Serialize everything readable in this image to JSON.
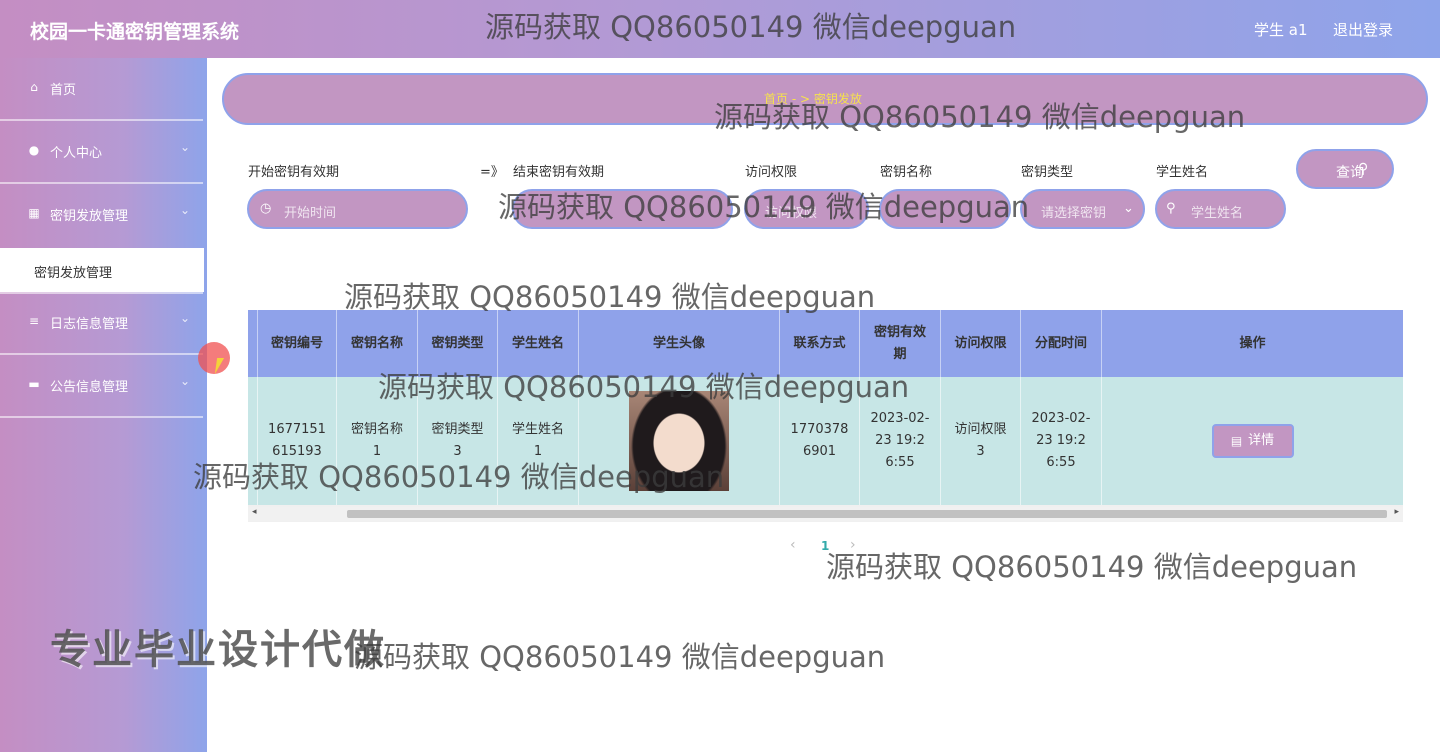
{
  "app": {
    "title": "校园一卡通密钥管理系统",
    "user": "学生 a1",
    "logout": "退出登录"
  },
  "sidebar": {
    "items": [
      {
        "label": "首页",
        "icon": "home-icon"
      },
      {
        "label": "个人中心",
        "icon": "user-icon"
      },
      {
        "label": "密钥发放管理",
        "icon": "grid-icon"
      },
      {
        "label": "日志信息管理",
        "icon": "list-icon"
      },
      {
        "label": "公告信息管理",
        "icon": "announce-icon"
      }
    ],
    "active_sub": "密钥发放管理"
  },
  "breadcrumb": {
    "text": "首页 - > 密钥发放"
  },
  "filters": {
    "start_label": "开始密钥有效期",
    "arrow": "=》",
    "end_label": "结束密钥有效期",
    "access_label": "访问权限",
    "keyname_label": "密钥名称",
    "keytype_label": "密钥类型",
    "student_label": "学生姓名",
    "start_placeholder": "开始时间",
    "access_placeholder": "访问权限",
    "keytype_placeholder": "请选择密钥",
    "student_placeholder": "学生姓名",
    "search_button": "查询"
  },
  "table": {
    "headers": [
      "密钥编号",
      "密钥名称",
      "密钥类型",
      "学生姓名",
      "学生头像",
      "联系方式",
      "密钥有效期",
      "访问权限",
      "分配时间",
      "操作"
    ],
    "rows": [
      {
        "key_no": "1677151615193",
        "key_name": "密钥名称1",
        "key_type": "密钥类型3",
        "student": "学生姓名1",
        "phone": "17703786901",
        "valid": "2023-02-23 19:26:55",
        "access": "访问权限3",
        "assigned": "2023-02-23 19:26:55",
        "action": "详情"
      }
    ]
  },
  "pager": {
    "current": "1",
    "prev": "‹",
    "next": "›"
  },
  "watermarks": {
    "text": "源码获取 QQ86050149 微信deepguan",
    "promo": "专业毕业设计代做"
  },
  "colors": {
    "accent_pink": "#c296c2",
    "accent_blue": "#8fa2ea",
    "row_bg": "#c7e6e6",
    "breadcrumb_text": "#f6e24c"
  }
}
